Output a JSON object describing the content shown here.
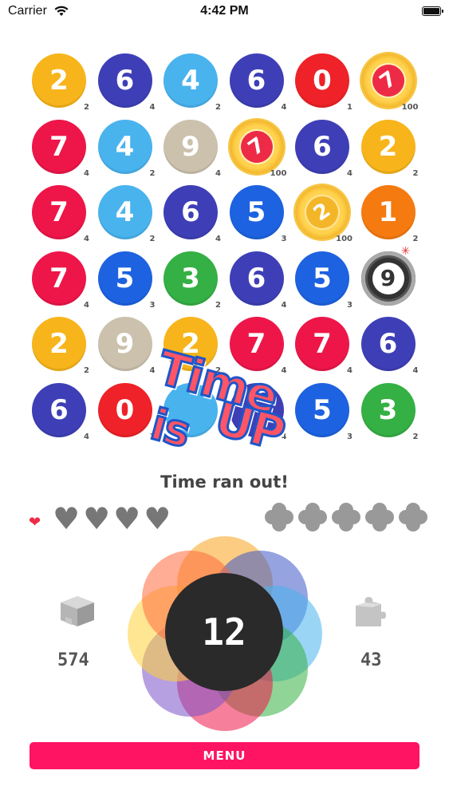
{
  "status_bar": {
    "carrier": "Carrier",
    "time": "4:42 PM"
  },
  "board": {
    "rows": [
      [
        {
          "num": "2",
          "sub": "2",
          "color": "#f7b51b",
          "kind": "ball"
        },
        {
          "num": "6",
          "sub": "4",
          "color": "#3e3fb7",
          "kind": "ball"
        },
        {
          "num": "4",
          "sub": "2",
          "color": "#49b3ee",
          "kind": "ball"
        },
        {
          "num": "6",
          "sub": "4",
          "color": "#3e3fb7",
          "kind": "ball"
        },
        {
          "num": "0",
          "sub": "1",
          "color": "#ee2228",
          "kind": "ball"
        },
        {
          "num": "7",
          "sub": "100",
          "color": "#ee2b46",
          "kind": "coin"
        }
      ],
      [
        {
          "num": "7",
          "sub": "4",
          "color": "#ee1649",
          "kind": "ball"
        },
        {
          "num": "4",
          "sub": "2",
          "color": "#49b3ee",
          "kind": "ball"
        },
        {
          "num": "9",
          "sub": "4",
          "color": "#cbc1ad",
          "kind": "ball"
        },
        {
          "num": "7",
          "sub": "100",
          "color": "#ee2b46",
          "kind": "coin"
        },
        {
          "num": "6",
          "sub": "4",
          "color": "#3e3fb7",
          "kind": "ball"
        },
        {
          "num": "2",
          "sub": "2",
          "color": "#f7b51b",
          "kind": "ball"
        }
      ],
      [
        {
          "num": "7",
          "sub": "4",
          "color": "#ee1649",
          "kind": "ball"
        },
        {
          "num": "4",
          "sub": "2",
          "color": "#49b3ee",
          "kind": "ball"
        },
        {
          "num": "6",
          "sub": "4",
          "color": "#3e3fb7",
          "kind": "ball"
        },
        {
          "num": "5",
          "sub": "3",
          "color": "#1d62e0",
          "kind": "ball"
        },
        {
          "num": "2",
          "sub": "100",
          "color": "#f4b629",
          "kind": "coin-gold"
        },
        {
          "num": "1",
          "sub": "2",
          "color": "#f57a10",
          "kind": "ball"
        }
      ],
      [
        {
          "num": "7",
          "sub": "4",
          "color": "#ee1649",
          "kind": "ball"
        },
        {
          "num": "5",
          "sub": "3",
          "color": "#1d62e0",
          "kind": "ball"
        },
        {
          "num": "3",
          "sub": "2",
          "color": "#35b044",
          "kind": "ball"
        },
        {
          "num": "6",
          "sub": "4",
          "color": "#3e3fb7",
          "kind": "ball"
        },
        {
          "num": "5",
          "sub": "3",
          "color": "#1d62e0",
          "kind": "ball"
        },
        {
          "num": "9",
          "sub": "",
          "color": "#333333",
          "kind": "bomb"
        }
      ],
      [
        {
          "num": "2",
          "sub": "2",
          "color": "#f7b51b",
          "kind": "ball"
        },
        {
          "num": "9",
          "sub": "4",
          "color": "#cbc1ad",
          "kind": "ball"
        },
        {
          "num": "2",
          "sub": "2",
          "color": "#f7b51b",
          "kind": "ball"
        },
        {
          "num": "7",
          "sub": "4",
          "color": "#ee1649",
          "kind": "ball"
        },
        {
          "num": "7",
          "sub": "4",
          "color": "#ee1649",
          "kind": "ball"
        },
        {
          "num": "6",
          "sub": "4",
          "color": "#3e3fb7",
          "kind": "ball"
        }
      ],
      [
        {
          "num": "6",
          "sub": "4",
          "color": "#3e3fb7",
          "kind": "ball"
        },
        {
          "num": "0",
          "sub": "1",
          "color": "#ee2228",
          "kind": "ball"
        },
        {
          "num": "",
          "sub": "",
          "color": "#49b3ee",
          "kind": "ball"
        },
        {
          "num": "",
          "sub": "4",
          "color": "#3e3fb7",
          "kind": "ball"
        },
        {
          "num": "5",
          "sub": "3",
          "color": "#1d62e0",
          "kind": "ball"
        },
        {
          "num": "3",
          "sub": "2",
          "color": "#35b044",
          "kind": "ball"
        }
      ]
    ]
  },
  "overlay": {
    "line1": "Time",
    "line2a": "is",
    "line2b": "UP"
  },
  "message": "Time ran out!",
  "lives": {
    "hearts_filled": 4,
    "clovers": 5
  },
  "score": {
    "center": "12",
    "left_count": "574",
    "right_count": "43"
  },
  "petal_colors": [
    "#f7a21b",
    "#3e57c9",
    "#49b3ee",
    "#35b044",
    "#ee1649",
    "#7a52c9",
    "#ffd23a",
    "#ff6a3d"
  ],
  "menu_label": "MENU"
}
